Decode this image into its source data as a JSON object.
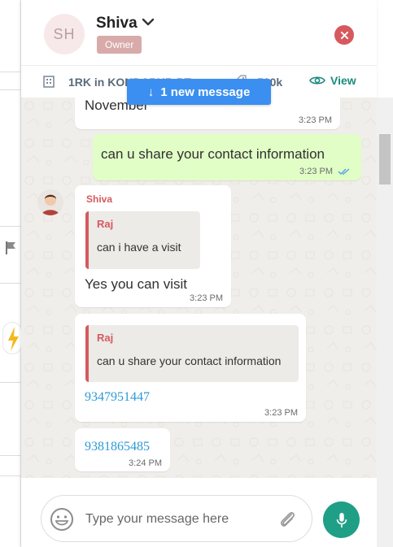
{
  "header": {
    "avatar_initials": "SH",
    "contact_name": "Shiva",
    "role_badge": "Owner",
    "icons": {
      "dropdown": "chevron-down-icon",
      "close": "close-icon"
    },
    "colors": {
      "badge": "#d9aaaa",
      "close": "#d6595e"
    }
  },
  "property_bar": {
    "title": "1RK in KONDAPUR,PT",
    "price": "510k",
    "view_label": "View",
    "icons": {
      "property": "building-icon",
      "price": "tag-icon",
      "view": "eye-icon"
    }
  },
  "new_message_pill": {
    "label": "1 new message",
    "arrow": "↓",
    "color": "#3a8ff0"
  },
  "messages": [
    {
      "id": "m1",
      "direction": "incoming",
      "text": "November",
      "time": "3:23 PM"
    },
    {
      "id": "m2",
      "direction": "outgoing",
      "text": "can u share your contact information",
      "time": "3:23 PM",
      "status": "read"
    },
    {
      "id": "m3",
      "direction": "incoming",
      "sender": "Shiva",
      "quote": {
        "author": "Raj",
        "text": "can i have a visit"
      },
      "text": "Yes you can visit",
      "time": "3:23 PM"
    },
    {
      "id": "m4",
      "direction": "incoming",
      "quote": {
        "author": "Raj",
        "text": "can u share your contact information"
      },
      "text": "9347951447",
      "time": "3:23 PM"
    },
    {
      "id": "m5",
      "direction": "incoming",
      "text": "9381865485",
      "time": "3:24 PM"
    }
  ],
  "composer": {
    "placeholder": "Type your message here",
    "icons": {
      "emoji": "emoji-icon",
      "attach": "paperclip-icon",
      "mic": "microphone-icon"
    },
    "mic_color": "#1f9f85"
  }
}
